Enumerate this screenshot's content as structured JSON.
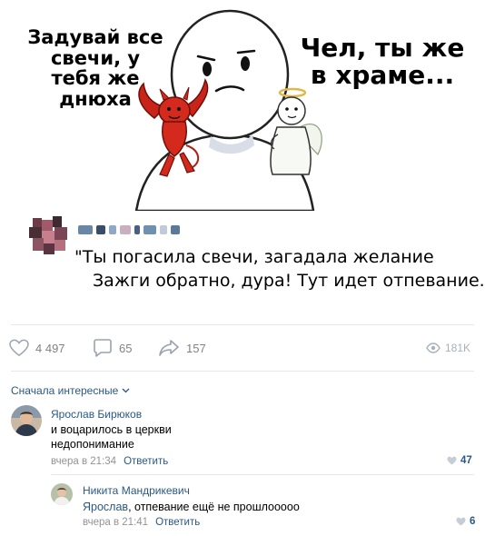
{
  "meme": {
    "left_caption": "Задувай все свечи, у тебя же днюха",
    "right_caption": "Чел, ты же в храме..."
  },
  "post": {
    "quote_line1": "\"Ты погасила свечи, загадала желание",
    "quote_line2": "Зажги обратно, дура! Тут идет отпевание.\""
  },
  "actions": {
    "likes": "4 497",
    "comments": "65",
    "shares": "157",
    "views": "181K"
  },
  "sort": {
    "label": "Сначала интересные"
  },
  "comments": [
    {
      "author": "Ярослав Бирюков",
      "text_line1": "и воцарилось в церкви",
      "text_line2": "недопонимание",
      "time": "вчера в 21:34",
      "reply": "Ответить",
      "likes": "47"
    },
    {
      "author": "Никита Мандрикевич",
      "mention": "Ярослав",
      "text": ", отпевание ещё не прошлооооо",
      "time": "вчера в 21:41",
      "reply": "Ответить",
      "likes": "6"
    }
  ],
  "colors": {
    "link": "#2a5885",
    "muted": "#939393",
    "devil": "#d42a1e",
    "divider": "#e7e8ec"
  }
}
